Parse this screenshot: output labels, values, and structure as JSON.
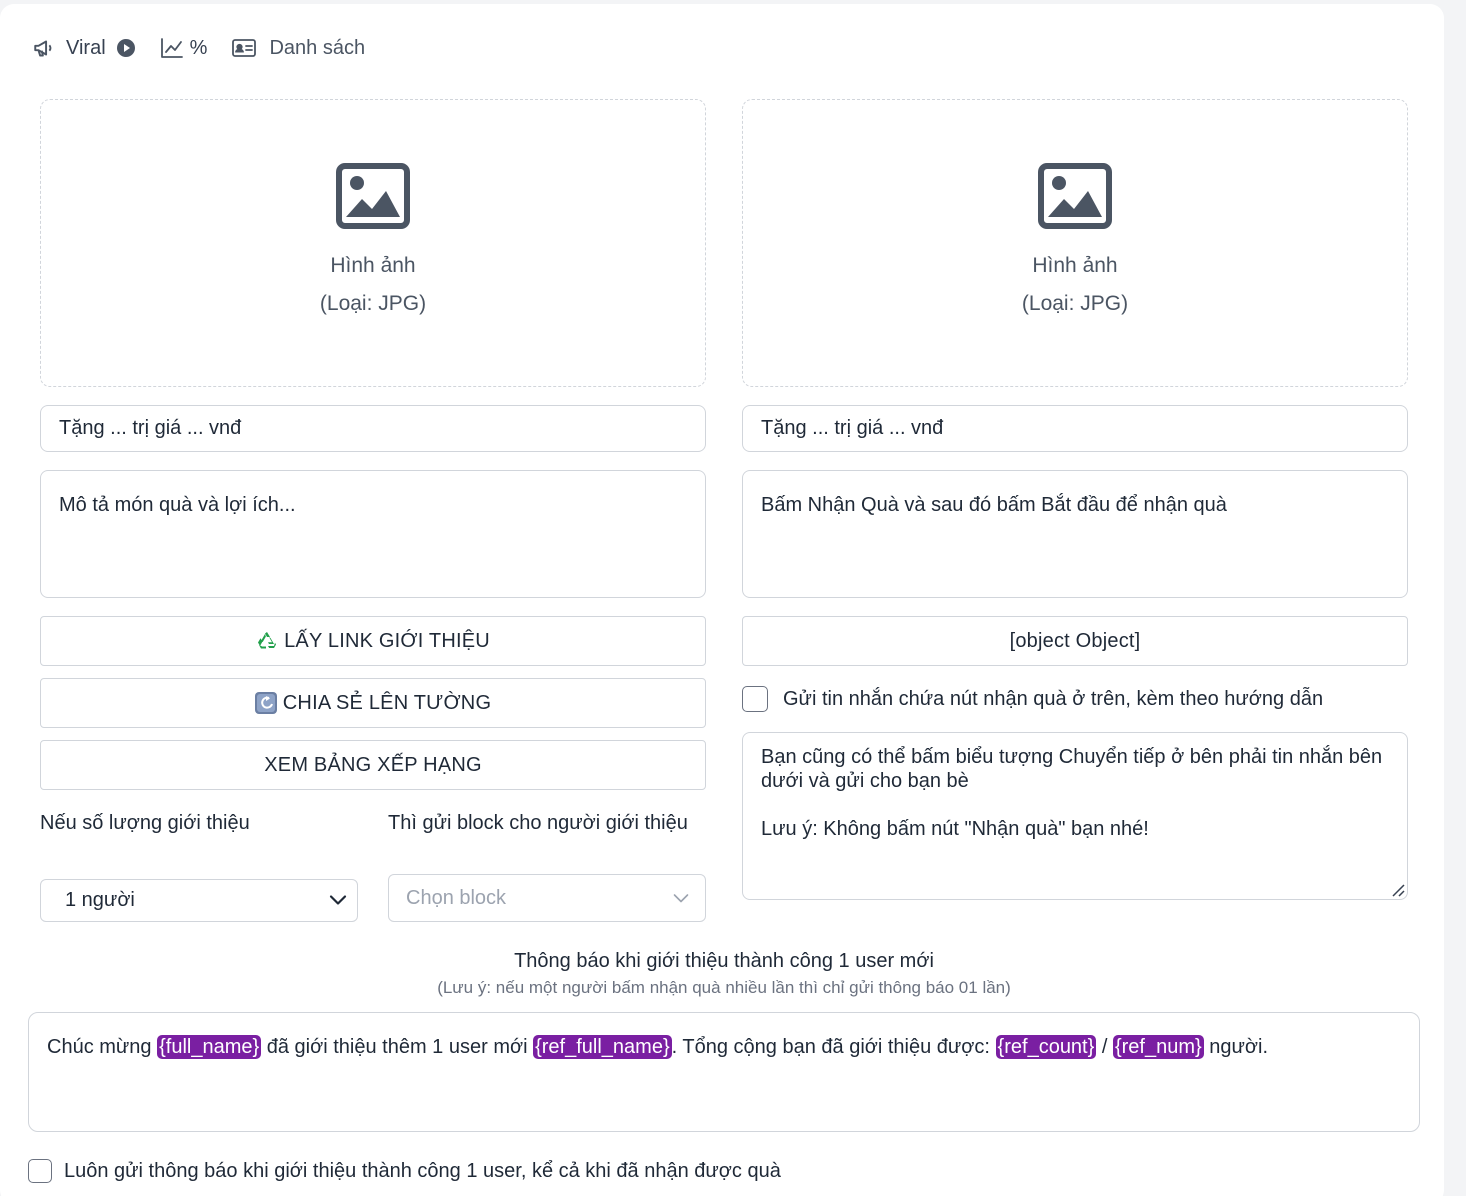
{
  "tabs": {
    "viral": "Viral",
    "percent": "%",
    "list": "Danh sách"
  },
  "left": {
    "upload_title": "Hình ảnh",
    "upload_type": "(Loại: JPG)",
    "gift_title_placeholder": "Tặng ... trị giá ... vnđ",
    "gift_desc_placeholder": "Mô tả món quà và lợi ích...",
    "btn_get_link": "LẤY LINK GIỚI THIỆU",
    "btn_share": "CHIA SẺ LÊN TƯỜNG",
    "btn_leaderboard": "XEM BẢNG XẾP HẠNG",
    "label_ref_count": "Nếu số lượng giới thiệu",
    "label_send_block": "Thì gửi block cho người giới thiệu",
    "select_ref_count": "1 người",
    "select_block_placeholder": "Chọn block"
  },
  "right": {
    "upload_title": "Hình ảnh",
    "upload_type": "(Loại: JPG)",
    "gift_title_placeholder": "Tặng ... trị giá ... vnđ",
    "instruction_text": "Bấm Nhận Quà và sau đó bấm Bắt đầu để nhận quà",
    "btn_object": "[object Object]",
    "checkbox_label": "Gửi tin nhắn chứa nút nhận quà ở trên, kèm theo hướng dẫn",
    "forward_text": "Bạn cũng có thể bấm biểu tượng Chuyển tiếp ở bên phải tin nhắn bên dưới và gửi cho bạn bè\n\nLưu ý: Không bấm nút \"Nhận quà\" bạn nhé!"
  },
  "notify": {
    "title": "Thông báo khi giới thiệu thành công 1 user mới",
    "note": "(Lưu ý: nếu một người bấm nhận quà nhiều lần thì chỉ gửi thông báo 01 lần)",
    "msg_part1": "Chúc mừng ",
    "var_full_name": "{full_name}",
    "msg_part2": " đã giới thiệu thêm 1 user mới ",
    "var_ref_full_name": "{ref_full_name}",
    "msg_part3": ". Tổng cộng bạn đã giới thiệu được: ",
    "var_ref_count": "{ref_count}",
    "msg_part4": " / ",
    "var_ref_num": "{ref_num}",
    "msg_part5": " người.",
    "always_send_label": "Luôn gửi thông báo khi giới thiệu thành công 1 user, kể cả khi đã nhận được quà"
  },
  "colors": {
    "chip_bg": "#7a1fa2",
    "border": "#d1d5db",
    "icon": "#4b5563"
  }
}
